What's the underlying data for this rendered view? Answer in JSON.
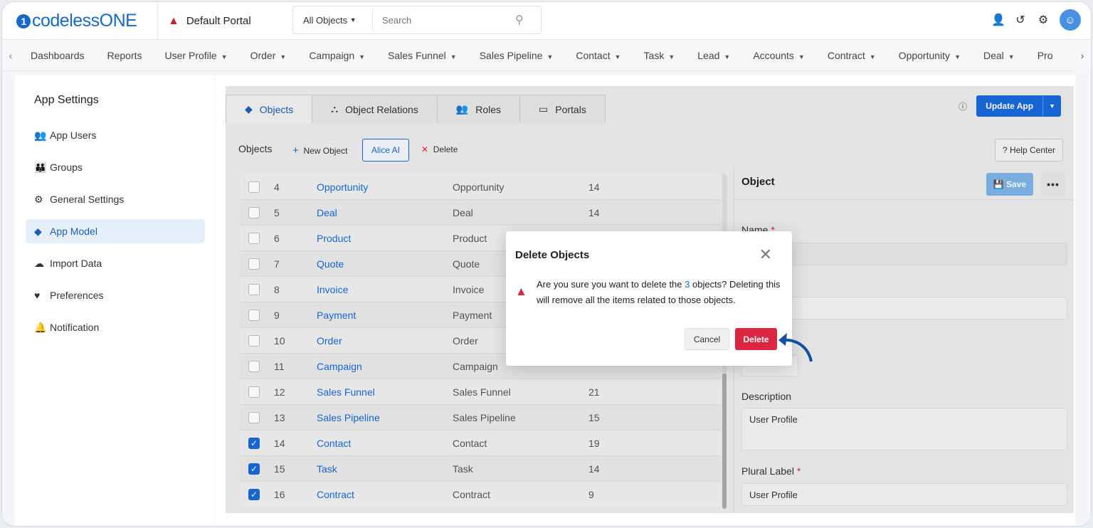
{
  "header": {
    "logo": "codelessONE",
    "portal": "Default Portal",
    "search_scope": "All Objects",
    "search_placeholder": "Search"
  },
  "nav": [
    "Dashboards",
    "Reports",
    "User Profile",
    "Order",
    "Campaign",
    "Sales Funnel",
    "Sales Pipeline",
    "Contact",
    "Task",
    "Lead",
    "Accounts",
    "Contract",
    "Opportunity",
    "Deal",
    "Pro"
  ],
  "nav_dropdown": [
    false,
    false,
    true,
    true,
    true,
    true,
    true,
    true,
    true,
    true,
    true,
    true,
    true,
    true,
    false
  ],
  "sidebar": {
    "title": "App Settings",
    "items": [
      {
        "label": "App Users",
        "icon": "users-icon"
      },
      {
        "label": "Groups",
        "icon": "groups-icon"
      },
      {
        "label": "General Settings",
        "icon": "gear-icon"
      },
      {
        "label": "App Model",
        "icon": "cube-icon"
      },
      {
        "label": "Import Data",
        "icon": "cloud-upload-icon"
      },
      {
        "label": "Preferences",
        "icon": "heart-hand-icon"
      },
      {
        "label": "Notification",
        "icon": "bell-icon"
      }
    ],
    "active": "App Model"
  },
  "tabs": [
    "Objects",
    "Object Relations",
    "Roles",
    "Portals"
  ],
  "update_app": "Update App",
  "toolbar": {
    "title": "Objects",
    "new_object": "New Object",
    "alice_ai": "Alice AI",
    "delete": "Delete",
    "help": "? Help Center"
  },
  "rows": [
    {
      "num": "4",
      "name": "Opportunity",
      "label": "Opportunity",
      "count": "14",
      "checked": false
    },
    {
      "num": "5",
      "name": "Deal",
      "label": "Deal",
      "count": "14",
      "checked": false
    },
    {
      "num": "6",
      "name": "Product",
      "label": "Product",
      "count": "",
      "checked": false
    },
    {
      "num": "7",
      "name": "Quote",
      "label": "Quote",
      "count": "",
      "checked": false
    },
    {
      "num": "8",
      "name": "Invoice",
      "label": "Invoice",
      "count": "",
      "checked": false
    },
    {
      "num": "9",
      "name": "Payment",
      "label": "Payment",
      "count": "",
      "checked": false
    },
    {
      "num": "10",
      "name": "Order",
      "label": "Order",
      "count": "",
      "checked": false
    },
    {
      "num": "11",
      "name": "Campaign",
      "label": "Campaign",
      "count": "",
      "checked": false
    },
    {
      "num": "12",
      "name": "Sales Funnel",
      "label": "Sales Funnel",
      "count": "21",
      "checked": false
    },
    {
      "num": "13",
      "name": "Sales Pipeline",
      "label": "Sales Pipeline",
      "count": "15",
      "checked": false
    },
    {
      "num": "14",
      "name": "Contact",
      "label": "Contact",
      "count": "19",
      "checked": true
    },
    {
      "num": "15",
      "name": "Task",
      "label": "Task",
      "count": "14",
      "checked": true
    },
    {
      "num": "16",
      "name": "Contract",
      "label": "Contract",
      "count": "9",
      "checked": true
    }
  ],
  "object_panel": {
    "title": "Object",
    "save": "Save",
    "name_label": "Name",
    "description_label": "Description",
    "description_value": "User Profile",
    "plural_label": "Plural Label",
    "plural_value": "User Profile"
  },
  "modal": {
    "title": "Delete Objects",
    "msg_before": "Are you sure you want to delete the ",
    "count": "3",
    "msg_after": " objects? Deleting this will remove all the items related to those objects.",
    "cancel": "Cancel",
    "delete": "Delete"
  },
  "colors": {
    "accent": "#1769d9",
    "danger": "#dc2541",
    "pointer": "#0d4fa8"
  }
}
